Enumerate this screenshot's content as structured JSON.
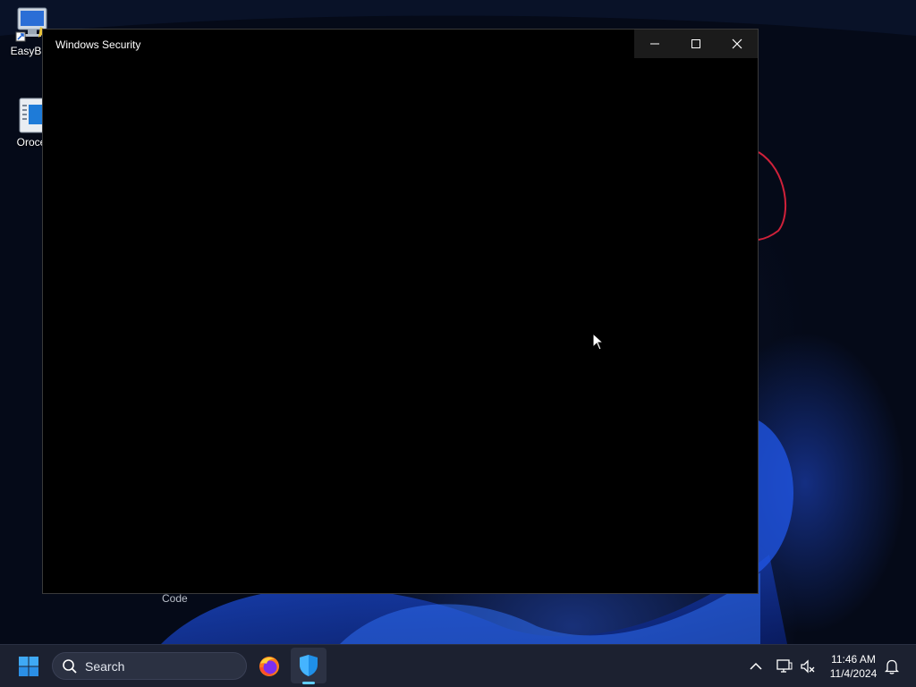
{
  "desktop": {
    "icons": [
      {
        "label": "EasyBCI"
      },
      {
        "label": "Oroce"
      }
    ],
    "partial_label": "Code"
  },
  "window": {
    "title": "Windows Security",
    "buttons": {
      "minimize": "minimize-icon",
      "maximize": "maximize-icon",
      "close": "close-icon"
    }
  },
  "taskbar": {
    "start_icon": "windows-start-icon",
    "search_placeholder": "Search",
    "apps": [
      {
        "name": "firefox-icon"
      },
      {
        "name": "windows-security-shield-icon",
        "active": true
      }
    ],
    "tray": {
      "overflow_icon": "chevron-up-icon",
      "network_icon": "network-icon",
      "volume_icon": "volume-muted-icon",
      "time": "11:46 AM",
      "date": "11/4/2024",
      "notification_icon": "bell-icon"
    }
  },
  "colors": {
    "accent": "#60cdff",
    "window_bg": "#000000",
    "taskbar_bg": "#1c2130"
  }
}
